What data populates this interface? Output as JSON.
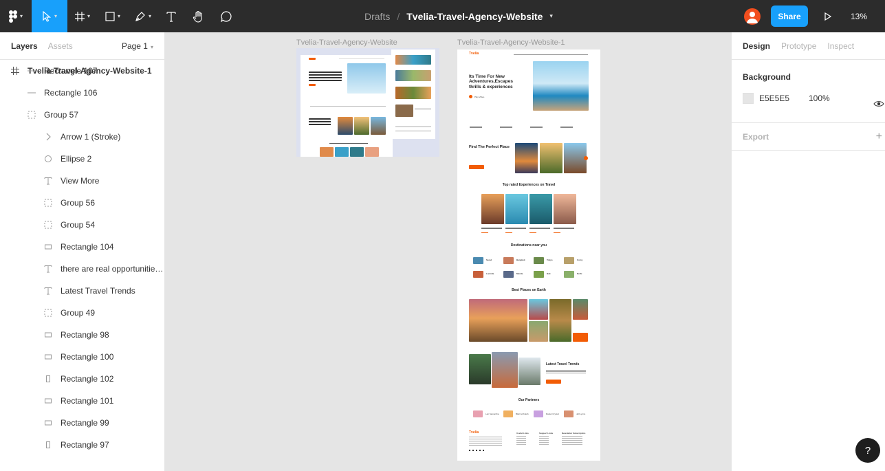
{
  "toolbar": {
    "breadcrumb": "Drafts",
    "separator": "/",
    "file_name": "Tvelia-Travel-Agency-Website",
    "share_label": "Share",
    "zoom": "13%"
  },
  "left_panel": {
    "tabs": [
      "Layers",
      "Assets"
    ],
    "page": "Page 1",
    "layers": [
      {
        "name": "Tvelia-Travel-Agency-Website-1",
        "icon": "frame-icon",
        "level": 0
      },
      {
        "name": "Rectangle 107",
        "icon": "line-icon",
        "level": 1
      },
      {
        "name": "Rectangle 106",
        "icon": "line-icon",
        "level": 1
      },
      {
        "name": "Group 57",
        "icon": "group-icon",
        "level": 1
      },
      {
        "name": "Arrow 1 (Stroke)",
        "icon": "arrow-icon",
        "level": 2
      },
      {
        "name": "Ellipse 2",
        "icon": "ellipse-icon",
        "level": 2
      },
      {
        "name": "View More",
        "icon": "text-icon",
        "level": 2
      },
      {
        "name": "Group 56",
        "icon": "group-icon",
        "level": 2
      },
      {
        "name": "Group 54",
        "icon": "group-icon",
        "level": 2
      },
      {
        "name": "Rectangle 104",
        "icon": "rectangle-icon",
        "level": 2
      },
      {
        "name": "there are real opportunities...",
        "icon": "text-icon",
        "level": 2
      },
      {
        "name": "Latest Travel Trends",
        "icon": "text-icon",
        "level": 2
      },
      {
        "name": "Group 49",
        "icon": "group-icon",
        "level": 2
      },
      {
        "name": "Rectangle 98",
        "icon": "rectangle-icon",
        "level": 2
      },
      {
        "name": "Rectangle 100",
        "icon": "rectangle-icon",
        "level": 2
      },
      {
        "name": "Rectangle 102",
        "icon": "rectangle-tall-icon",
        "level": 2
      },
      {
        "name": "Rectangle 101",
        "icon": "rectangle-icon",
        "level": 2
      },
      {
        "name": "Rectangle 99",
        "icon": "rectangle-icon",
        "level": 2
      },
      {
        "name": "Rectangle 97",
        "icon": "rectangle-tall-icon",
        "level": 2
      }
    ]
  },
  "canvas": {
    "frame1_label": "Tvelia-Travel-Agency-Website",
    "frame2_label": "Tvelia-Travel-Agency-Website-1",
    "site": {
      "logo": "Tvelia",
      "nav": [
        "Home",
        "Resort",
        "Adventures",
        "Island",
        "Services",
        "Login",
        "Signin"
      ],
      "hero_title": "Its Time For New Adventures,Escapes thrills & experiences",
      "hero_cta": "Play Video",
      "find_title": "Find The Perfect Place",
      "top_rated": "Top rated Experiences on Travel",
      "destinations": "Destinations near you",
      "best_places": "Best Places on Earth",
      "latest": "Latest Travel Trends",
      "partners": "Our Partners",
      "footer_logo": "Tvelia",
      "dest_names": [
        "Seoul",
        "Bangkok",
        "Tokyo",
        "Corrg",
        "Lanmila",
        "Manila",
        "Bali",
        "Delhi"
      ],
      "partner_names": [
        "Lan Samantha",
        "Blair Anthuiah",
        "Daniel Crystal",
        "Jell Lynns"
      ],
      "footer_cols": [
        "Useful Links",
        "Support Links",
        "Newsletter Subscription"
      ]
    }
  },
  "right_panel": {
    "tabs": [
      "Design",
      "Prototype",
      "Inspect"
    ],
    "background_title": "Background",
    "bg_hex": "E5E5E5",
    "bg_opacity": "100%",
    "export_title": "Export"
  },
  "help_label": "?",
  "colors": {
    "accent": "#18a0fb",
    "brand_orange": "#f25c05",
    "toolbar_bg": "#2c2c2c",
    "canvas_bg": "#e5e5e5"
  }
}
